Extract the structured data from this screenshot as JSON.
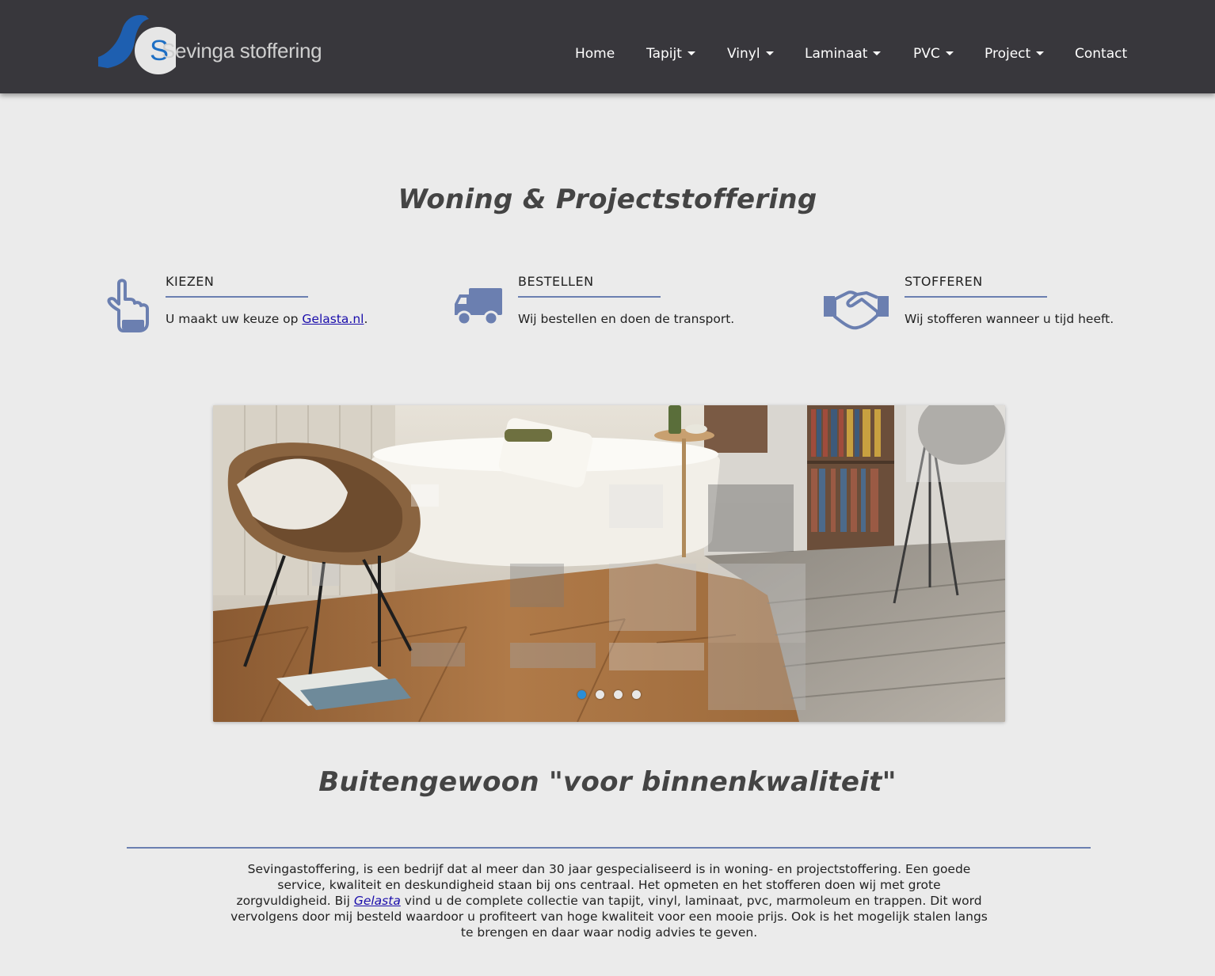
{
  "header": {
    "logo_text": "Sevinga stoffering",
    "nav": [
      {
        "label": "Home",
        "dropdown": false
      },
      {
        "label": "Tapijt",
        "dropdown": true
      },
      {
        "label": "Vinyl",
        "dropdown": true
      },
      {
        "label": "Laminaat",
        "dropdown": true
      },
      {
        "label": "PVC",
        "dropdown": true
      },
      {
        "label": "Project",
        "dropdown": true
      },
      {
        "label": "Contact",
        "dropdown": false
      }
    ]
  },
  "main_title": "Woning & Projectstoffering",
  "features": [
    {
      "icon": "hand-pointer-icon",
      "title": "KIEZEN",
      "text_before": "U maakt uw keuze op ",
      "link": "Gelasta.nl",
      "text_after": "."
    },
    {
      "icon": "truck-icon",
      "title": "BESTELLEN",
      "text": "Wij bestellen en doen de transport."
    },
    {
      "icon": "handshake-icon",
      "title": "STOFFEREN",
      "text": "Wij stofferen wanneer u tijd heeft."
    }
  ],
  "slider": {
    "slide_count": 4,
    "active_index": 0
  },
  "slogan": "Buitengewoon \"voor binnenkwaliteit\"",
  "about": {
    "part1": "Sevingastoffering, is een bedrijf dat al meer dan 30 jaar gespecialiseerd is in woning- en projectstoffering. Een goede service, kwaliteit en deskundigheid staan bij ons centraal. Het opmeten en het stofferen doen wij met grote zorgvuldigheid. Bij ",
    "link": "Gelasta",
    "part2": " vind u de complete collectie van tapijt, vinyl, laminaat, pvc, marmoleum en trappen. Dit word vervolgens door mij besteld waardoor u profiteert van hoge kwaliteit voor een mooie prijs. Ook is het mogelijk stalen langs te brengen en daar waar nodig advies te geven."
  },
  "colors": {
    "header_bg": "#38373c",
    "accent": "#6b7fb0",
    "icon": "#6b7fb0",
    "dot_active": "#2a8ed6",
    "link": "#1a0dab"
  }
}
